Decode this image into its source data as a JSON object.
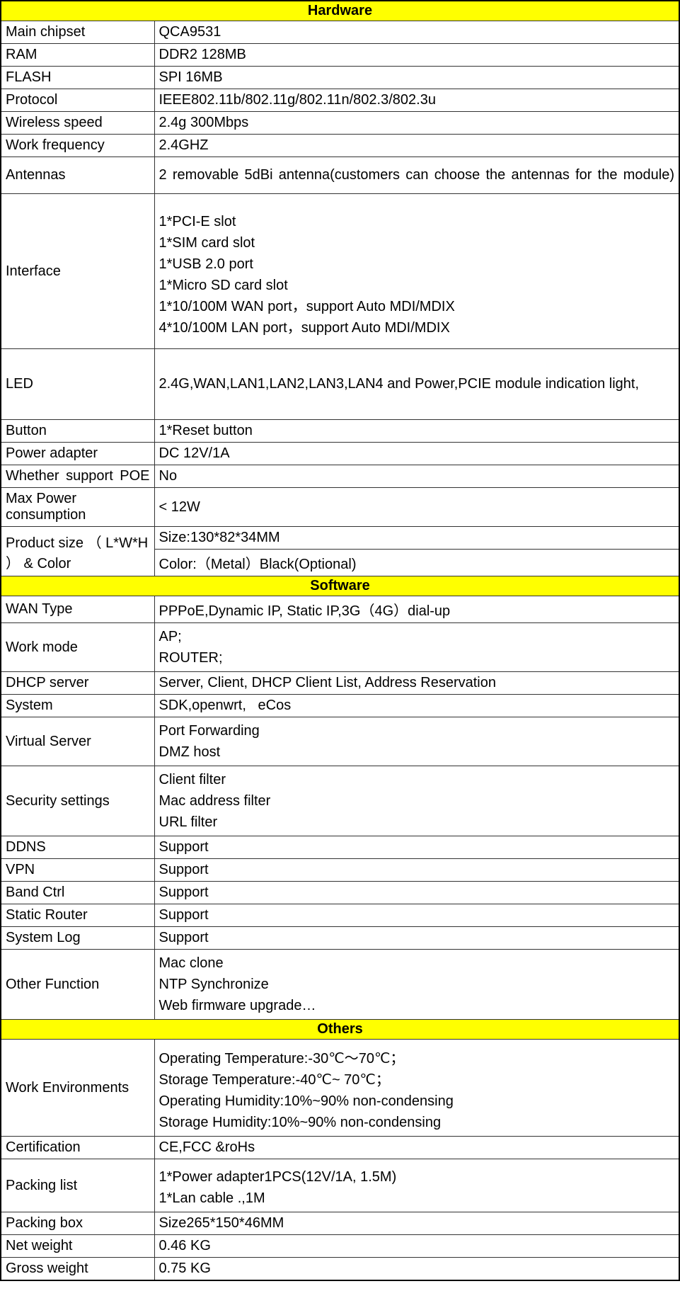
{
  "sections": {
    "hardware": {
      "title": "Hardware",
      "rows": {
        "main_chipset": {
          "label": "Main chipset",
          "value": "QCA9531"
        },
        "ram": {
          "label": "RAM",
          "value": "DDR2 128MB"
        },
        "flash": {
          "label": "FLASH",
          "value": "SPI 16MB"
        },
        "protocol": {
          "label": "Protocol",
          "value": "IEEE802.11b/802.11g/802.11n/802.3/802.3u"
        },
        "wireless_speed": {
          "label": "Wireless speed",
          "value": "2.4g 300Mbps"
        },
        "work_frequency": {
          "label": "Work frequency",
          "value": "2.4GHZ"
        },
        "antennas": {
          "label": "Antennas",
          "value": "2 removable 5dBi antenna(customers can choose the antennas for the module)"
        },
        "interface": {
          "label": "Interface",
          "line1": "1*PCI-E slot",
          "line2": "1*SIM card slot",
          "line3": "1*USB 2.0 port",
          "line4": "1*Micro SD card slot",
          "line5": "1*10/100M WAN port，support Auto MDI/MDIX",
          "line6": "4*10/100M LAN port，support Auto MDI/MDIX"
        },
        "led": {
          "label": "LED",
          "value": "2.4G,WAN,LAN1,LAN2,LAN3,LAN4 and Power,PCIE module indication light,"
        },
        "button": {
          "label": "Button",
          "value": "1*Reset button"
        },
        "power_adapter": {
          "label": "Power adapter",
          "value": "DC 12V/1A"
        },
        "poe": {
          "label": "Whether support POE",
          "value": "No"
        },
        "max_power": {
          "label": "Max Power consumption",
          "value": "< 12W"
        },
        "product_size": {
          "label": "Product size （ L*W*H ） & Color",
          "value1": "Size:130*82*34MM",
          "value2": "Color:（Metal）Black(Optional)"
        }
      }
    },
    "software": {
      "title": "Software",
      "rows": {
        "wan_type": {
          "label": "WAN Type",
          "value": "PPPoE,Dynamic IP, Static IP,3G（4G）dial-up"
        },
        "work_mode": {
          "label": "Work mode",
          "line1": "AP;",
          "line2": "ROUTER;"
        },
        "dhcp": {
          "label": "DHCP server",
          "value": "Server, Client, DHCP Client List, Address Reservation"
        },
        "system": {
          "label": "System",
          "value": "SDK,openwrt,   eCos"
        },
        "virtual_server": {
          "label": "Virtual Server",
          "line1": "Port Forwarding",
          "line2": "DMZ host"
        },
        "security": {
          "label": "Security settings",
          "line1": "Client filter",
          "line2": "Mac address filter",
          "line3": "URL filter"
        },
        "ddns": {
          "label": "DDNS",
          "value": "Support"
        },
        "vpn": {
          "label": "VPN",
          "value": "Support"
        },
        "band_ctrl": {
          "label": "Band Ctrl",
          "value": "Support"
        },
        "static_router": {
          "label": "Static Router",
          "value": "Support"
        },
        "system_log": {
          "label": "System Log",
          "value": "Support"
        },
        "other_function": {
          "label": "Other Function",
          "line1": "Mac clone",
          "line2": "NTP Synchronize",
          "line3": "Web firmware upgrade…"
        }
      }
    },
    "others": {
      "title": "Others",
      "rows": {
        "work_env": {
          "label": "Work Environments",
          "line1": "Operating Temperature:-30℃～70℃；",
          "line2": "Storage Temperature:-40℃~ 70℃；",
          "line3": "Operating Humidity:10%~90% non-condensing",
          "line4": "Storage Humidity:10%~90% non-condensing"
        },
        "certification": {
          "label": "Certification",
          "value": "CE,FCC &roHs"
        },
        "packing_list": {
          "label": "Packing list",
          "line1": "1*Power adapter1PCS(12V/1A, 1.5M)",
          "line2": "1*Lan cable .,1M"
        },
        "packing_box": {
          "label": "Packing box",
          "value": "Size265*150*46MM"
        },
        "net_weight": {
          "label": "Net weight",
          "value": "0.46 KG"
        },
        "gross_weight": {
          "label": "Gross weight",
          "value": "0.75 KG"
        }
      }
    }
  }
}
